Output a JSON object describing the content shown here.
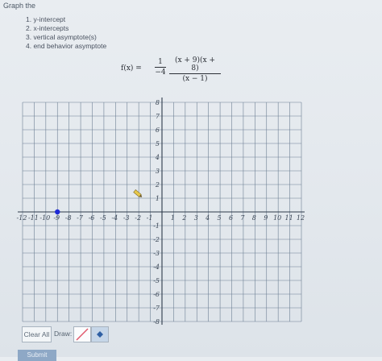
{
  "title": "Graph the",
  "steps": [
    "1. y-intercept",
    "2. x-intercepts",
    "3. vertical asymptote(s)",
    "4. end behavior asymptote"
  ],
  "formula": {
    "lhs": "f(x) =",
    "coef_num": "1",
    "coef_den": "−4",
    "num": "(x + 9)(x + 8)",
    "den": "(x − 1)"
  },
  "graph": {
    "x_range": [
      -12,
      12
    ],
    "y_range": [
      -8,
      8
    ],
    "x_labels": [
      "-12",
      "-11",
      "-10",
      "-9",
      "-8",
      "-7",
      "-6",
      "-5",
      "-4",
      "-3",
      "-2",
      "-1",
      "1",
      "2",
      "3",
      "4",
      "5",
      "6",
      "7",
      "8",
      "9",
      "10",
      "11",
      "12"
    ],
    "y_labels": [
      "8",
      "7",
      "6",
      "5",
      "4",
      "3",
      "2",
      "1",
      "-1",
      "-2",
      "-3",
      "-4",
      "-5",
      "-6",
      "-7",
      "-8"
    ],
    "points": [
      {
        "x": -9,
        "y": 0
      }
    ],
    "point_color": "#1f2bd6",
    "grid_color": "#6d7f93",
    "axis_color": "#2d3a4a"
  },
  "toolbar": {
    "clear_label": "Clear All",
    "draw_label": "Draw:",
    "line_icon": "line-tool-icon",
    "point_icon": "point-tool-icon"
  },
  "submit_label": "Submit"
}
